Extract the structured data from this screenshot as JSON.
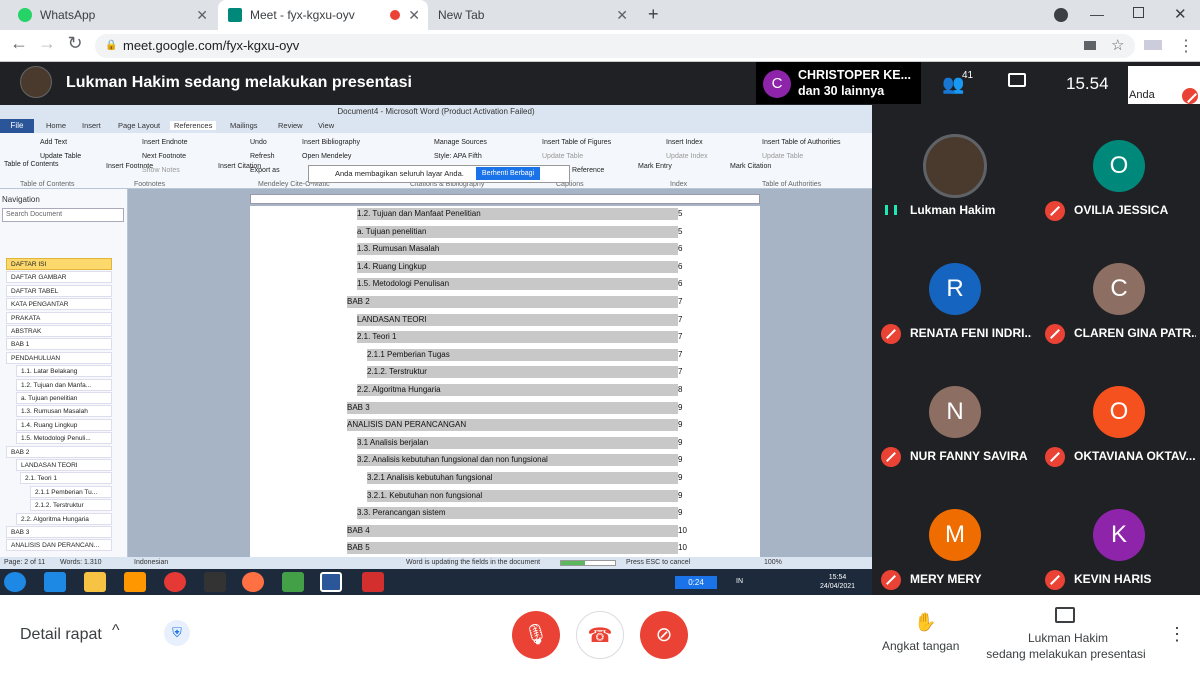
{
  "browser": {
    "tabs": [
      {
        "label": "WhatsApp",
        "color": "#25d366"
      },
      {
        "label": "Meet - fyx-kgxu-oyv",
        "color": "#00897b",
        "recording": true
      },
      {
        "label": "New Tab"
      }
    ],
    "url": "meet.google.com/fyx-kgxu-oyv",
    "new_tab": "+"
  },
  "meet_header": {
    "presentation_title": "Lukman Hakim sedang melakukan presentasi",
    "notification": {
      "initial": "C",
      "line1": "CHRISTOPER KE...",
      "line2": "dan 30 lainnya"
    },
    "people_count": "41",
    "time": "15.54",
    "self_label": "Anda"
  },
  "word": {
    "title": "Document4 - Microsoft Word (Product Activation Failed)",
    "tabs": [
      "File",
      "Home",
      "Insert",
      "Page Layout",
      "References",
      "Mailings",
      "Review",
      "View"
    ],
    "ribbon": {
      "table_of_contents": "Table of Contents",
      "add_text": "Add Text",
      "update_table": "Update Table",
      "insert_footnote": "Insert Footnote",
      "insert_endnote": "Insert Endnote",
      "next_footnote": "Next Footnote",
      "show_notes": "Show Notes",
      "insert_citation": "Insert Citation",
      "undo": "Undo",
      "refresh": "Refresh",
      "export": "Export as",
      "insert_bibliography": "Insert Bibliography",
      "open_mendeley": "Open Mendeley",
      "manage_sources": "Manage Sources",
      "style": "Style: APA Fifth",
      "insert_table_figures": "Insert Table of Figures",
      "update_table2": "Update Table",
      "cross_reference": "Reference",
      "mark_entry": "Mark Entry",
      "insert_index": "Insert Index",
      "update_index": "Update Index",
      "mark_citation": "Mark Citation",
      "insert_toa": "Insert Table of Authorities",
      "update_table3": "Update Table",
      "groups": [
        "Table of Contents",
        "Footnotes",
        "Mendeley Cite-O-Matic",
        "Citations & Bibliography",
        "Captions",
        "Index",
        "Table of Authorities"
      ]
    },
    "share_notice": "Anda membagikan seluruh layar Anda.",
    "stop_sharing": "Berhenti Berbagi",
    "navigation": {
      "title": "Navigation",
      "search_placeholder": "Search Document",
      "items": [
        "DAFTAR ISI",
        "DAFTAR GAMBAR",
        "DAFTAR TABEL",
        "KATA PENGANTAR",
        "PRAKATA",
        "ABSTRAK",
        "BAB 1",
        "PENDAHULUAN",
        "1.1.   Latar Belakang",
        "1.2. Tujuan dan Manfa...",
        "a. Tujuan penelitian",
        "1.3.  Rumusan Masalah",
        "1.4. Ruang Lingkup",
        "1.5. Metodologi Penuli...",
        "BAB 2",
        "LANDASAN TEORI",
        "2.1. Teori 1",
        "2.1.1 Pemberian Tu...",
        "2.1.2. Terstruktur",
        "2.2. Algoritma Hungaria",
        "BAB 3",
        "ANALISIS DAN PERANCAN..."
      ]
    },
    "toc": [
      {
        "text": "1.2.      Tujuan dan Manfaat Penelitian",
        "page": "5"
      },
      {
        "text": "a.     Tujuan penelitian",
        "page": "5"
      },
      {
        "text": "1.3.      Rumusan Masalah",
        "page": "6"
      },
      {
        "text": "1.4.      Ruang Lingkup",
        "page": "6"
      },
      {
        "text": "1.5.      Metodologi Penulisan",
        "page": "6"
      },
      {
        "text": "BAB 2",
        "page": "7"
      },
      {
        "text": "LANDASAN TEORI",
        "page": "7"
      },
      {
        "text": "2.1. Teori 1",
        "page": "7"
      },
      {
        "text": "2.1.1 Pemberian Tugas",
        "page": "7"
      },
      {
        "text": "2.1.2. Terstruktur",
        "page": "7"
      },
      {
        "text": "2.2. Algoritma Hungaria",
        "page": "8"
      },
      {
        "text": "BAB 3",
        "page": "9"
      },
      {
        "text": "ANALISIS DAN PERANCANGAN",
        "page": "9"
      },
      {
        "text": "3.1 Analisis berjalan",
        "page": "9"
      },
      {
        "text": "3.2. Analisis kebutuhan fungsional dan non fungsional",
        "page": "9"
      },
      {
        "text": "3.2.1 Analisis kebutuhan fungsional",
        "page": "9"
      },
      {
        "text": "3.2.1. Kebutuhan non fungsional",
        "page": "9"
      },
      {
        "text": "3.3. Perancangan sistem",
        "page": "9"
      },
      {
        "text": "BAB 4",
        "page": "10"
      },
      {
        "text": "BAB 5",
        "page": "10"
      }
    ],
    "status": {
      "page": "Page: 2 of 11",
      "words": "Words: 1.310",
      "language": "Indonesian",
      "updating": "Word is updating the fields in the document",
      "esc": "Press ESC to cancel",
      "zoom": "100%"
    },
    "taskbar": {
      "timer": "0:24",
      "lang": "IN",
      "time": "15:54",
      "date": "24/04/2021"
    }
  },
  "participants": [
    {
      "name": "Lukman Hakim",
      "initial": "",
      "color": "#4a3a2e",
      "speaking": true
    },
    {
      "name": "OVILIA JESSICA",
      "initial": "O",
      "color": "#00897b",
      "muted": true
    },
    {
      "name": "RENATA FENI INDRI...",
      "initial": "R",
      "color": "#1565c0",
      "muted": true
    },
    {
      "name": "CLAREN GINA PATR...",
      "initial": "C",
      "color": "#8d6e63",
      "muted": true
    },
    {
      "name": "NUR FANNY SAVIRA",
      "initial": "N",
      "color": "#8d6e63",
      "muted": true
    },
    {
      "name": "OKTAVIANA OKTAV...",
      "initial": "O",
      "color": "#f4511e",
      "muted": true
    },
    {
      "name": "MERY MERY",
      "initial": "M",
      "color": "#ef6c00",
      "muted": true
    },
    {
      "name": "KEVIN HARIS",
      "initial": "K",
      "color": "#8e24aa",
      "muted": true
    }
  ],
  "bottom": {
    "details": "Detail rapat",
    "raise_hand": "Angkat tangan",
    "presenting_line1": "Lukman Hakim",
    "presenting_line2": "sedang melakukan presentasi"
  }
}
